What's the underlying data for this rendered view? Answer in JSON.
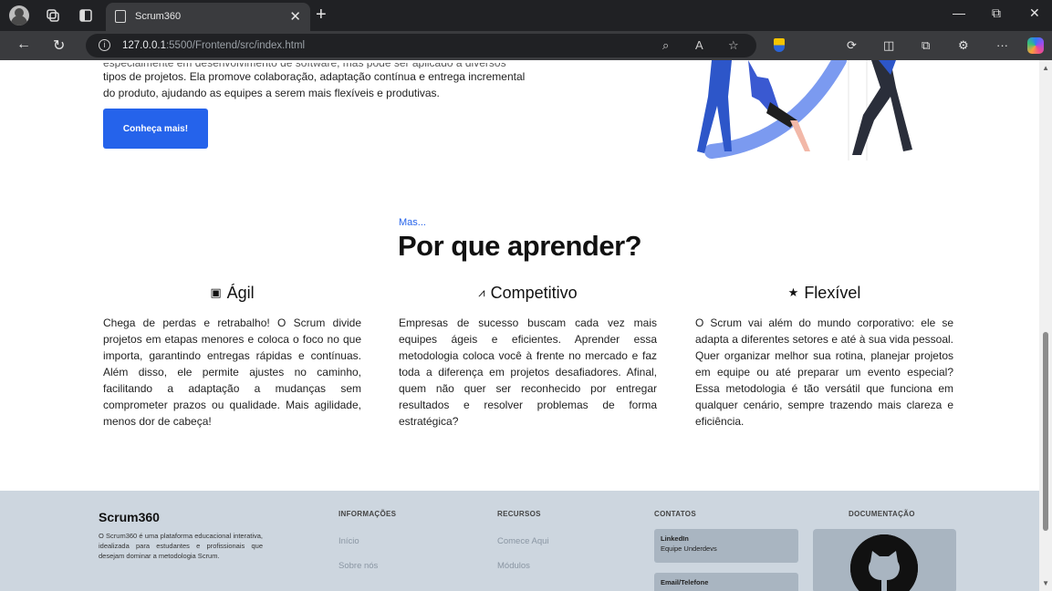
{
  "browser": {
    "tab_title": "Scrum360",
    "url_host": "127.0.0.1",
    "url_rest": ":5500/Frontend/src/index.html"
  },
  "hero": {
    "text_partial_top": "especialmente em desenvolvimento de software, mas pode ser aplicado a diversos",
    "text_line2": "tipos de projetos. Ela promove colaboração, adaptação contínua e entrega incremental",
    "text_line3": "do produto, ajudando as equipes a serem mais flexíveis e produtivas.",
    "button_label": "Conheça mais!"
  },
  "why": {
    "kicker": "Mas...",
    "title": "Por que aprender?",
    "features": [
      {
        "icon": "clipboard-icon",
        "glyph": "▣",
        "title": "Ágil",
        "body": "Chega de perdas e retrabalho! O Scrum divide projetos em etapas menores e coloca o foco no que importa, garantindo entregas rápidas e contínuas. Além disso, ele permite ajustes no caminho, facilitando a adaptação a mudanças sem comprometer prazos ou qualidade. Mais agilidade, menos dor de cabeça!"
      },
      {
        "icon": "chart-icon",
        "glyph": "⩘",
        "title": "Competitivo",
        "body": "Empresas de sucesso buscam cada vez mais equipes ágeis e eficientes. Aprender essa metodologia coloca você à frente no mercado e faz toda a diferença em projetos desafiadores. Afinal, quem não quer ser reconhecido por entregar resultados e resolver problemas de forma estratégica?"
      },
      {
        "icon": "star-icon",
        "glyph": "★",
        "title": "Flexível",
        "body": "O Scrum vai além do mundo corporativo: ele se adapta a diferentes setores e até à sua vida pessoal. Quer organizar melhor sua rotina, planejar projetos em equipe ou até preparar um evento especial? Essa metodologia é tão versátil que funciona em qualquer cenário, sempre trazendo mais clareza e eficiência."
      }
    ]
  },
  "footer": {
    "brand": "Scrum360",
    "description": "O Scrum360 é uma plataforma educacional interativa, idealizada para estudantes e profissionais que desejam dominar a metodologia Scrum.",
    "info_heading": "INFORMAÇÕES",
    "info_links": [
      "Início",
      "Sobre nós"
    ],
    "resources_heading": "RECURSOS",
    "resources_links": [
      "Comece Aqui",
      "Módulos"
    ],
    "contacts_heading": "CONTATOS",
    "contact_linkedin_title": "LinkedIn",
    "contact_linkedin_value": "Equipe Underdevs",
    "contact_email_title": "Email/Telefone",
    "docs_heading": "DOCUMENTAÇÃO"
  },
  "colors": {
    "accent": "#2563eb",
    "footer_bg": "#cdd6df",
    "card_bg": "#a9b5c1"
  }
}
